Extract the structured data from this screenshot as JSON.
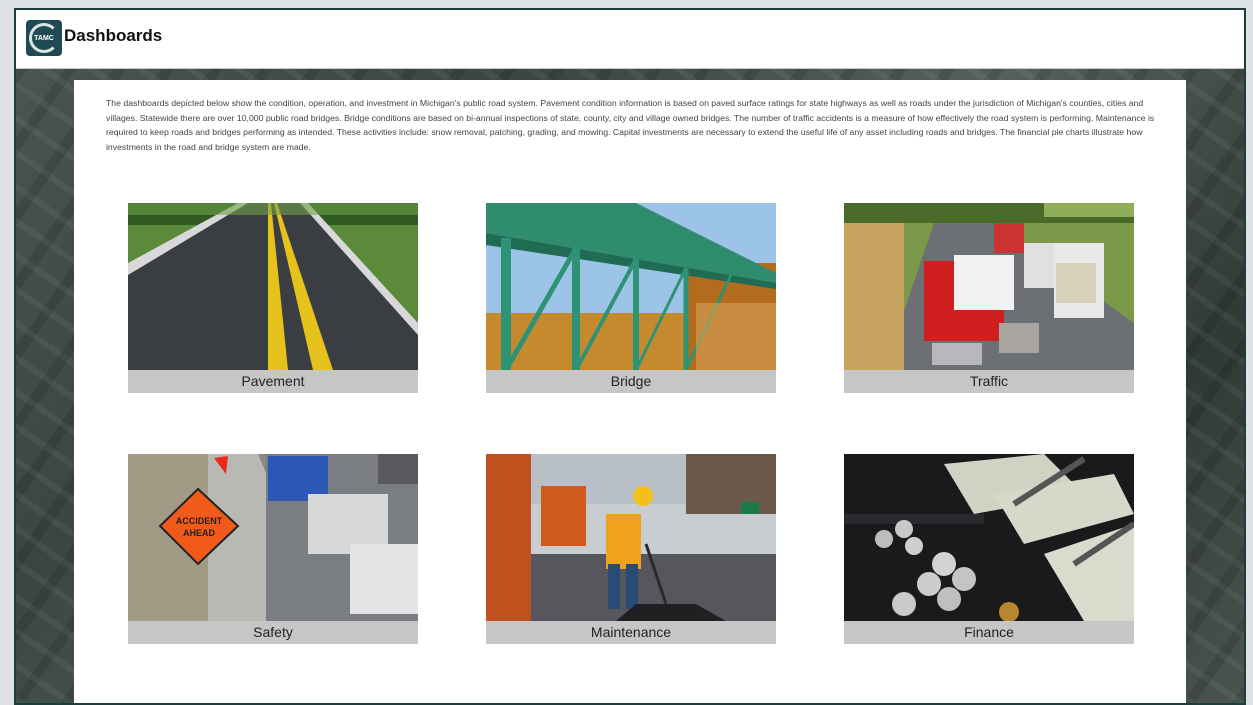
{
  "header": {
    "logo_text": "TAMC",
    "title": "Dashboards"
  },
  "intro": {
    "text": "The dashboards depicted below show the condition, operation, and investment in Michigan's public road system. Pavement condition information is based on paved surface ratings for state highways as well as roads under the jurisdiction of Michigan's counties, cities and villages. Statewide there are over 10,000 public road bridges. Bridge conditions are based on bi-annual inspections of state, county, city and village owned bridges. The number of traffic accidents is a measure of how effectively the road system is performing. Maintenance is required to keep roads and bridges performing as intended. These activities include: snow removal, patching, grading, and mowing. Capital investments are necessary to extend the useful life of any asset including roads and bridges. The financial pie charts illustrate how investments in the road and bridge system are made."
  },
  "tiles": [
    {
      "label": "Pavement"
    },
    {
      "label": "Bridge"
    },
    {
      "label": "Traffic"
    },
    {
      "label": "Safety",
      "sign_text_1": "ACCIDENT",
      "sign_text_2": "AHEAD"
    },
    {
      "label": "Maintenance"
    },
    {
      "label": "Finance"
    }
  ]
}
